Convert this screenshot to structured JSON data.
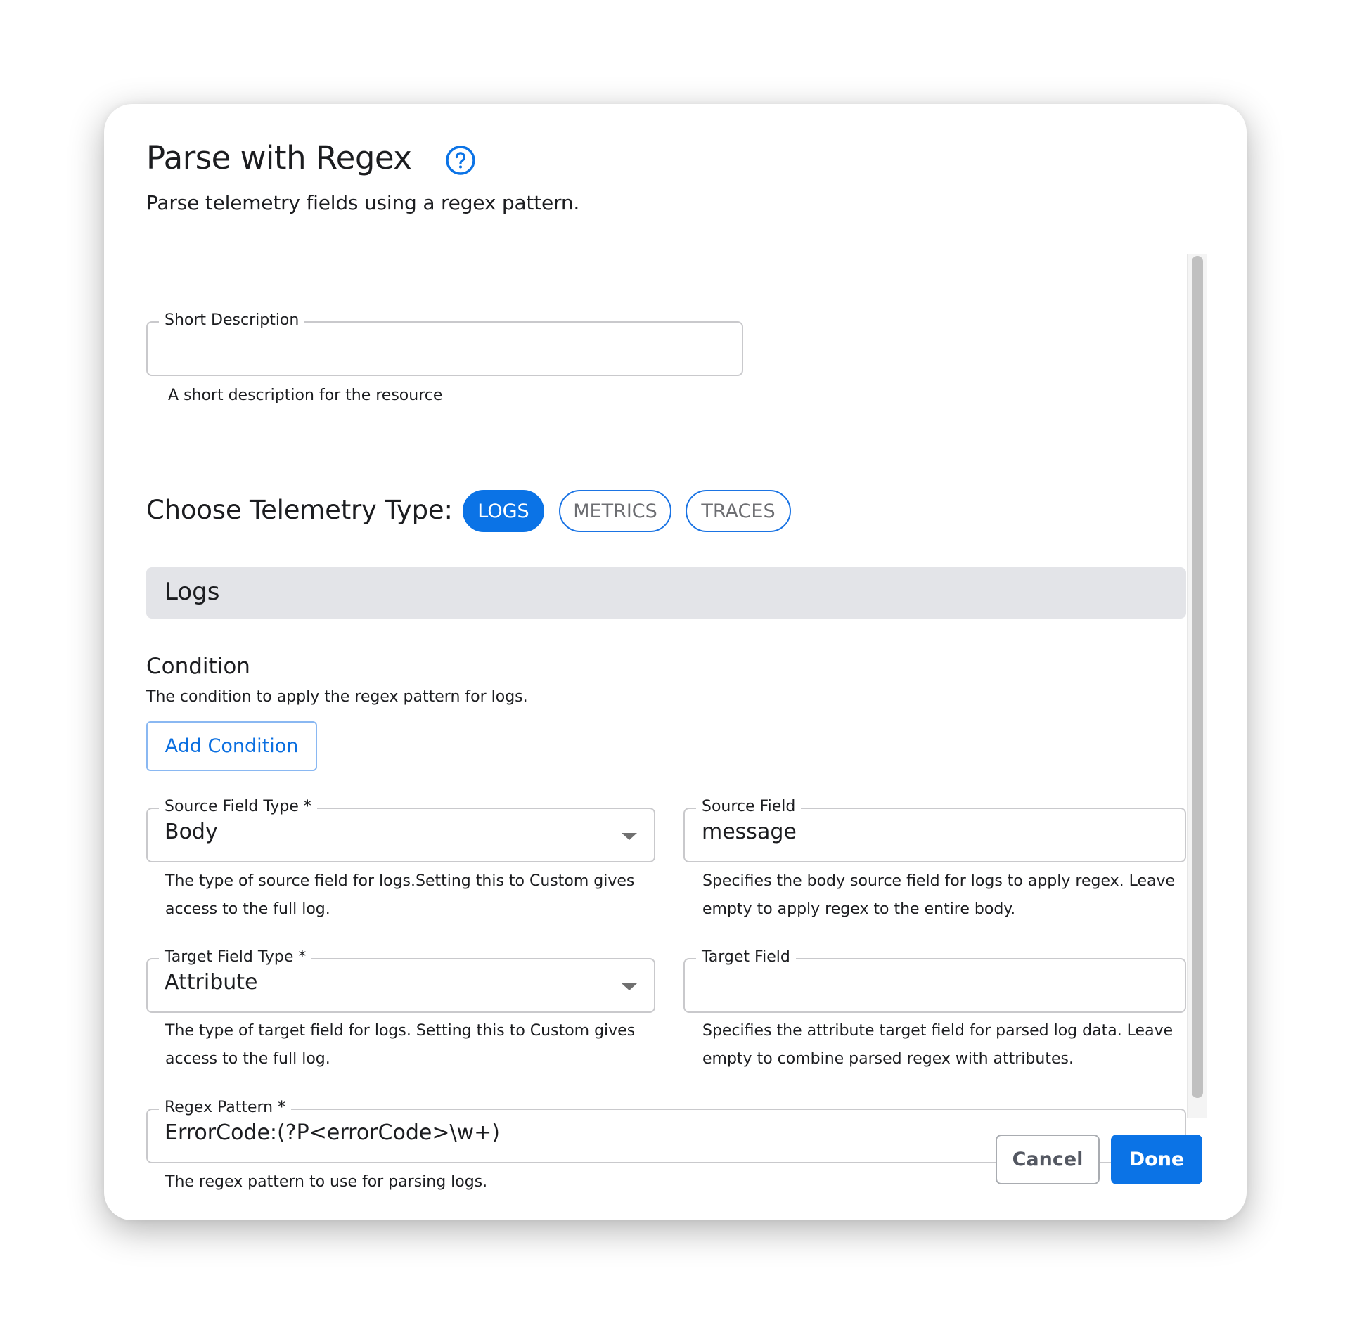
{
  "dialog": {
    "title": "Parse with Regex",
    "help_icon": "help-circle-icon",
    "subtitle": "Parse telemetry fields using a regex pattern."
  },
  "short_description": {
    "label": "Short Description",
    "value": "",
    "helper": "A short description for the resource"
  },
  "telemetry": {
    "label": "Choose Telemetry Type:",
    "options": [
      {
        "label": "LOGS",
        "selected": true
      },
      {
        "label": "METRICS",
        "selected": false
      },
      {
        "label": "TRACES",
        "selected": false
      }
    ]
  },
  "section": {
    "title": "Logs"
  },
  "condition": {
    "title": "Condition",
    "description": "The condition to apply the regex pattern for logs.",
    "add_button": "Add Condition"
  },
  "fields": {
    "source_field_type": {
      "label": "Source Field Type *",
      "value": "Body",
      "helper": "The type of source field for logs.Setting this to Custom gives access to the full log."
    },
    "source_field": {
      "label": "Source Field",
      "value": "message",
      "helper": "Specifies the body source field for logs to apply regex. Leave empty to apply regex to the entire body."
    },
    "target_field_type": {
      "label": "Target Field Type *",
      "value": "Attribute",
      "helper": "The type of target field for logs. Setting this to Custom gives access to the full log."
    },
    "target_field": {
      "label": "Target Field",
      "value": "",
      "helper": "Specifies the attribute target field for parsed log data. Leave empty to combine parsed regex with attributes."
    },
    "regex_pattern": {
      "label": "Regex Pattern *",
      "value": "ErrorCode:(?P<errorCode>\\w+)",
      "helper": "The regex pattern to use for parsing logs."
    }
  },
  "footer": {
    "cancel_label": "Cancel",
    "done_label": "Done"
  },
  "colors": {
    "accent": "#0b73e6",
    "section_band": "#e3e4e8",
    "border": "#c9c9cc"
  }
}
